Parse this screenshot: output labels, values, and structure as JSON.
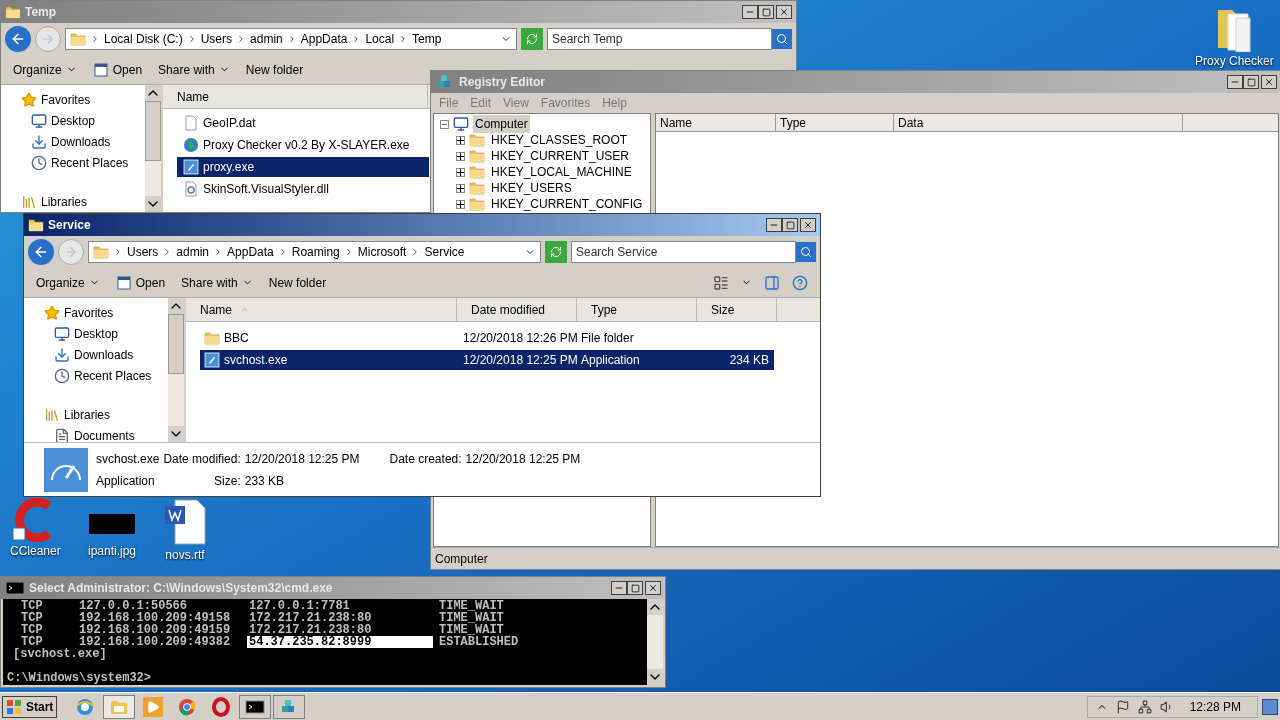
{
  "desktop_icons": [
    {
      "label": "Proxy Checker",
      "kind": "folder"
    },
    {
      "label": "CCleaner",
      "kind": "cleaner"
    },
    {
      "label": "ipanti.jpg",
      "kind": "image"
    },
    {
      "label": "novs.rtf",
      "kind": "document"
    }
  ],
  "temp_window": {
    "title": "Temp",
    "active": false,
    "breadcrumb": [
      "Local Disk (C:)",
      "Users",
      "admin",
      "AppData",
      "Local",
      "Temp"
    ],
    "search": {
      "placeholder": "Search Temp"
    },
    "toolbar": [
      "Organize",
      "Open",
      "Share with",
      "New folder"
    ],
    "nav": [
      {
        "label": "Favorites",
        "kind": "favorites"
      },
      {
        "label": "Desktop",
        "kind": "desktop"
      },
      {
        "label": "Downloads",
        "kind": "downloads"
      },
      {
        "label": "Recent Places",
        "kind": "recent"
      },
      {
        "label": "Libraries",
        "kind": "libraries"
      }
    ],
    "columns": [
      "Name"
    ],
    "files": [
      {
        "name": "GeoIP.dat",
        "kind": "file",
        "selected": false
      },
      {
        "name": "Proxy Checker v0.2 By X-SLAYER.exe",
        "kind": "globe",
        "selected": false
      },
      {
        "name": "proxy.exe",
        "kind": "app",
        "selected": true
      },
      {
        "name": "SkinSoft.VisualStyler.dll",
        "kind": "dll",
        "selected": false
      }
    ]
  },
  "registry_window": {
    "title": "Registry Editor",
    "active": false,
    "menu": [
      "File",
      "Edit",
      "View",
      "Favorites",
      "Help"
    ],
    "tree": [
      {
        "label": "Computer",
        "kind": "computer",
        "expanded": true,
        "selected": true,
        "children": [
          {
            "label": "HKEY_CLASSES_ROOT",
            "kind": "folder",
            "expanded": false,
            "selected": false
          },
          {
            "label": "HKEY_CURRENT_USER",
            "kind": "folder",
            "expanded": false,
            "selected": false
          },
          {
            "label": "HKEY_LOCAL_MACHINE",
            "kind": "folder",
            "expanded": false,
            "selected": false
          },
          {
            "label": "HKEY_USERS",
            "kind": "folder",
            "expanded": false,
            "selected": false
          },
          {
            "label": "HKEY_CURRENT_CONFIG",
            "kind": "folder",
            "expanded": false,
            "selected": false
          }
        ]
      }
    ],
    "columns": [
      "Name",
      "Type",
      "Data"
    ],
    "status_bar": "Computer"
  },
  "service_window": {
    "title": "Service",
    "active": true,
    "breadcrumb": [
      "Users",
      "admin",
      "AppData",
      "Roaming",
      "Microsoft",
      "Service"
    ],
    "search": {
      "placeholder": "Search Service"
    },
    "toolbar": [
      "Organize",
      "Open",
      "Share with",
      "New folder"
    ],
    "nav": [
      {
        "label": "Favorites",
        "kind": "favorites"
      },
      {
        "label": "Desktop",
        "kind": "desktop"
      },
      {
        "label": "Downloads",
        "kind": "downloads"
      },
      {
        "label": "Recent Places",
        "kind": "recent"
      },
      {
        "label": "Libraries",
        "kind": "libraries"
      },
      {
        "label": "Documents",
        "kind": "documents"
      }
    ],
    "columns": [
      "Name",
      "Date modified",
      "Type",
      "Size"
    ],
    "files": [
      {
        "name": "BBC",
        "date": "12/20/2018 12:26 PM",
        "type": "File folder",
        "kind": "folder",
        "selected": false
      },
      {
        "name": "svchost.exe",
        "date": "12/20/2018 12:25 PM",
        "type": "Application",
        "size": "234 KB",
        "kind": "app",
        "selected": true
      }
    ],
    "details": {
      "name": "svchost.exe",
      "type": "Application",
      "modified_label": "Date modified:",
      "modified": "12/20/2018 12:25 PM",
      "created_label": "Date created:",
      "created": "12/20/2018 12:25 PM",
      "size_label": "Size:",
      "size": "233 KB"
    }
  },
  "cmd_window": {
    "title": "Select Administrator: C:\\Windows\\System32\\cmd.exe",
    "active": false,
    "rows": [
      {
        "cells": [
          "TCP",
          "127.0.0.1:50566",
          "127.0.0.1:7781",
          "TIME_WAIT"
        ],
        "selected": false
      },
      {
        "cells": [
          "TCP",
          "192.168.100.209:49158",
          "172.217.21.238:80",
          "TIME_WAIT"
        ],
        "selected": false
      },
      {
        "cells": [
          "TCP",
          "192.168.100.209:49159",
          "172.217.21.238:80",
          "TIME_WAIT"
        ],
        "selected": false
      },
      {
        "cells": [
          "TCP",
          "192.168.100.209:49382",
          "54.37.235.82:8999",
          "ESTABLISHED"
        ],
        "selected": true
      }
    ],
    "process": "[svchost.exe]",
    "prompt": "C:\\Windows\\system32>"
  },
  "taskbar": {
    "start": "Start",
    "items": [
      {
        "kind": "browser",
        "selected": false
      },
      {
        "kind": "explorer",
        "selected": true
      },
      {
        "kind": "media",
        "selected": false
      },
      {
        "kind": "chrome",
        "selected": false
      },
      {
        "kind": "opera",
        "selected": false
      },
      {
        "kind": "terminal",
        "selected": false
      },
      {
        "kind": "registry",
        "selected": false
      }
    ],
    "clock": "12:28 PM"
  }
}
